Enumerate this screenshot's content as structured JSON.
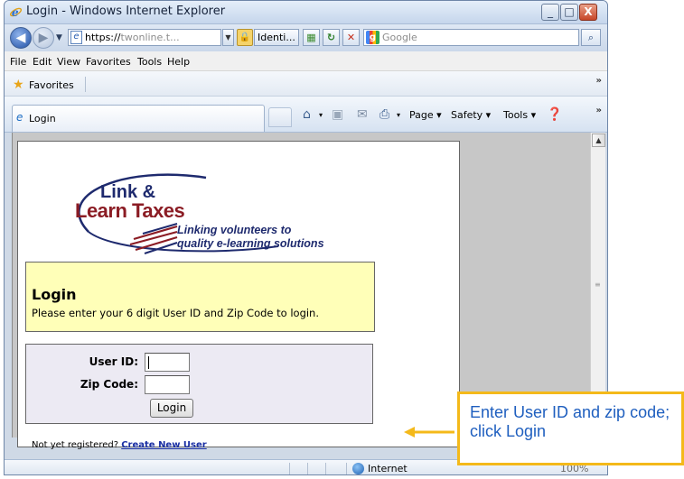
{
  "window": {
    "title": "Login - Windows Internet Explorer",
    "minimize": "_",
    "maximize": "□",
    "close": "X"
  },
  "address_bar": {
    "url_prefix": "https://",
    "url_gray": "twonline.t...",
    "identity_label": "Identi...",
    "search_placeholder": "Google"
  },
  "menu": {
    "items": [
      "File",
      "Edit",
      "View",
      "Favorites",
      "Tools",
      "Help"
    ]
  },
  "favorites_bar": {
    "label": "Favorites"
  },
  "tab": {
    "title": "Login"
  },
  "command_bar": {
    "page": "Page ▾",
    "safety": "Safety ▾",
    "tools": "Tools ▾"
  },
  "page": {
    "logo_line1": "Link &",
    "logo_line2": "Learn Taxes",
    "logo_tagline1": "Linking volunteers to",
    "logo_tagline2": "quality e-learning solutions",
    "heading": "Login",
    "instructions": "Please enter your 6 digit User ID and Zip Code to login.",
    "user_id_label": "User ID:",
    "zip_label": "Zip Code:",
    "user_id_value": "",
    "zip_value": "",
    "login_button": "Login",
    "register_text": "Not yet registered?",
    "register_link": "Create New User"
  },
  "status_bar": {
    "zone": "Internet",
    "zoom": "100%"
  },
  "callout": {
    "text": "Enter User ID and zip code; click Login",
    "border_color": "#f4b91a",
    "text_color": "#1f5fbf"
  }
}
